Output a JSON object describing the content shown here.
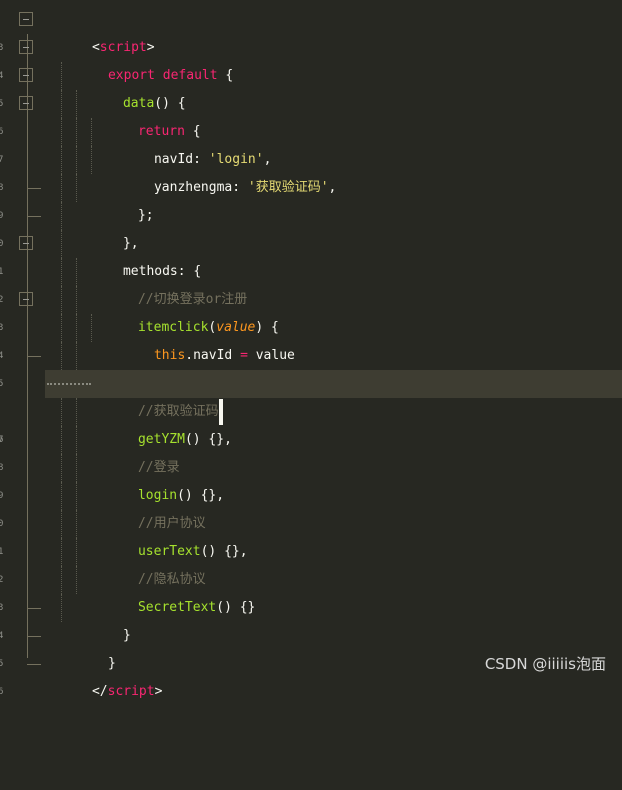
{
  "line_numbers": [
    "3",
    "4",
    "5",
    "6",
    "7",
    "8",
    "9",
    "0",
    "1",
    "2",
    "3",
    "4",
    "5",
    "6",
    "7",
    "8",
    "9",
    "0",
    "1",
    "2",
    "3",
    "4",
    "5",
    "6"
  ],
  "code": {
    "l1": {
      "open": "<",
      "tag": "script",
      "close": ">"
    },
    "l2": {
      "kw1": "export",
      "kw2": "default",
      "rest": " {"
    },
    "l3": {
      "fn": "data",
      "rest": "() {"
    },
    "l4": {
      "kw": "return",
      "rest": " {"
    },
    "l5": {
      "key": "navId: ",
      "str": "'login'",
      "rest": ","
    },
    "l6": {
      "key": "yanzhengma: ",
      "str": "'获取验证码'",
      "rest": ","
    },
    "l7": {
      "text": "};"
    },
    "l8": {
      "text": "},"
    },
    "l9": {
      "text": "methods: {"
    },
    "l10": {
      "comment": "//切换登录or注册"
    },
    "l11": {
      "fn": "itemclick",
      "open": "(",
      "param": "value",
      "rest": ") {"
    },
    "l12": {
      "this": "this",
      "mid": ".navId ",
      "op": "=",
      "rest": " value"
    },
    "l13": {
      "text": "},"
    },
    "l14": {
      "comment": "//获取验证码"
    },
    "l15": {
      "fn": "getYZM",
      "rest": "() {},"
    },
    "l16": {
      "comment": "//登录"
    },
    "l17": {
      "fn": "login",
      "rest": "() {},"
    },
    "l18": {
      "comment": "//用户协议"
    },
    "l19": {
      "fn": "userText",
      "rest": "() {},"
    },
    "l20": {
      "comment": "//隐私协议"
    },
    "l21": {
      "fn": "SecretText",
      "rest": "() {}"
    },
    "l22": {
      "text": "}"
    },
    "l23": {
      "text": "}"
    },
    "l24": {
      "open": "</",
      "tag": "script",
      "close": ">"
    }
  },
  "watermark": "CSDN @iiiiis泡面",
  "colors": {
    "background": "#272822",
    "keyword": "#f92672",
    "function": "#a6e22e",
    "string": "#e6db74",
    "comment": "#75715e",
    "parameter": "#fd971f"
  }
}
